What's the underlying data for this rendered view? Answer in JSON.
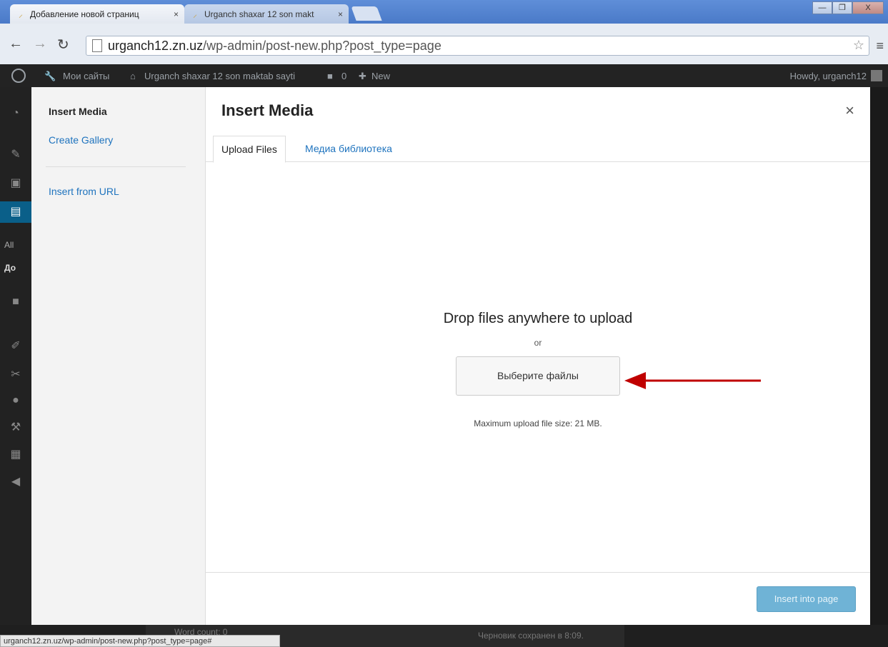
{
  "browser": {
    "tabs": [
      {
        "label": "Добавление новой страниц",
        "close": "×"
      },
      {
        "label": "Urganch shaxar 12 son makt",
        "close": "×"
      }
    ],
    "window_buttons": [
      "—",
      "❐",
      "X"
    ],
    "url_host": "urganch12.zn.uz",
    "url_path": "/wp-admin/post-new.php?post_type=page"
  },
  "adminbar": {
    "my_sites": "Мои сайты",
    "site_name": "Urganch shaxar 12 son maktab sayti",
    "comments": "0",
    "new": "New",
    "howdy": "Howdy, urganch12"
  },
  "adminmenu": {
    "all": "All",
    "add": "До"
  },
  "modal": {
    "sidebar": {
      "title": "Insert Media",
      "create_gallery": "Create Gallery",
      "insert_from_url": "Insert from URL"
    },
    "title": "Insert Media",
    "close": "×",
    "tabs": [
      {
        "label": "Upload Files"
      },
      {
        "label": "Медиа библиотека"
      }
    ],
    "drop_title": "Drop files anywhere to upload",
    "or": "or",
    "select_button": "Выберите файлы",
    "max_size": "Maximum upload file size: 21 MB.",
    "insert_button": "Insert into page"
  },
  "footer": {
    "word_count": "Word count: 0",
    "draft_saved": "Черновик сохранен в 8:09."
  },
  "status_url": "urganch12.zn.uz/wp-admin/post-new.php?post_type=page#",
  "colors": {
    "link": "#1e73be",
    "arrow": "#c00000",
    "insert_button": "#6fb3d6"
  }
}
